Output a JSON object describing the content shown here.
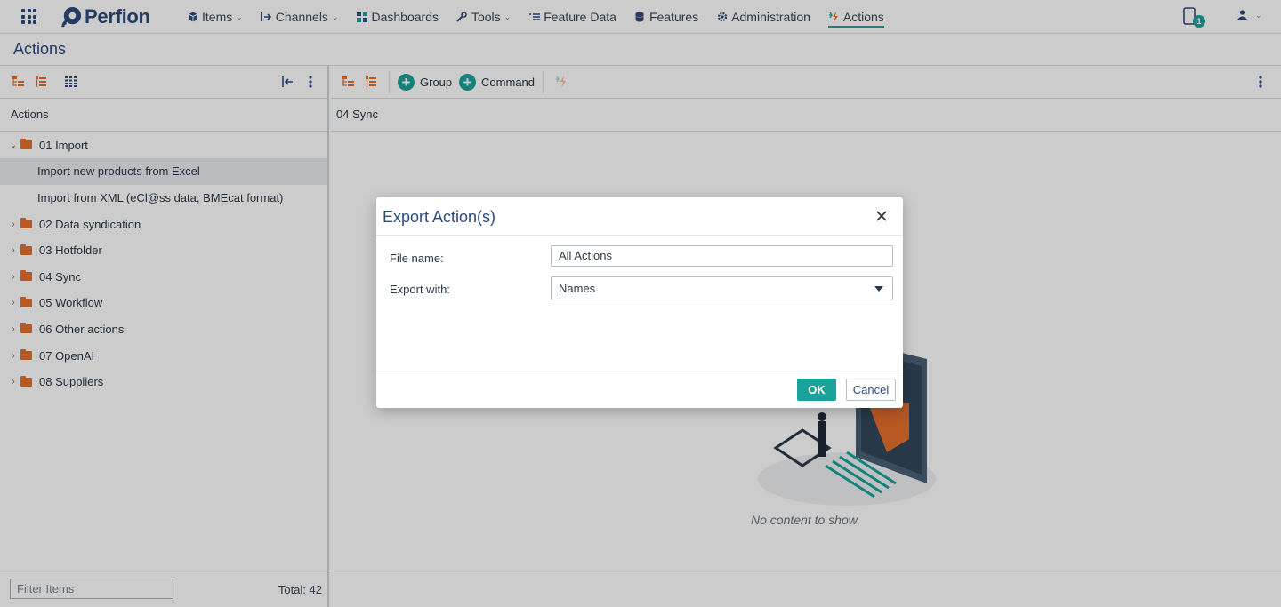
{
  "brand": {
    "name": "Perfion"
  },
  "colors": {
    "accent": "#1aa39a",
    "brand": "#2e4a7d",
    "folder": "#e66f2c"
  },
  "nav": {
    "items": [
      {
        "label": "Items",
        "icon": "cube-icon",
        "has_dropdown": true
      },
      {
        "label": "Channels",
        "icon": "channels-icon",
        "has_dropdown": true
      },
      {
        "label": "Dashboards",
        "icon": "dashboard-icon",
        "has_dropdown": false
      },
      {
        "label": "Tools",
        "icon": "wrench-icon",
        "has_dropdown": true
      },
      {
        "label": "Feature Data",
        "icon": "list-icon",
        "has_dropdown": false
      },
      {
        "label": "Features",
        "icon": "database-icon",
        "has_dropdown": false
      },
      {
        "label": "Administration",
        "icon": "gear-icon",
        "has_dropdown": false
      },
      {
        "label": "Actions",
        "icon": "actions-icon",
        "has_dropdown": false,
        "active": true
      }
    ],
    "notification_count": "1"
  },
  "page": {
    "title": "Actions"
  },
  "left_panel": {
    "header": "Actions",
    "tree": [
      {
        "label": "01 Import",
        "expanded": true
      },
      {
        "label": "Import new products from Excel",
        "child": true,
        "selected": true
      },
      {
        "label": "Import from XML (eCl@ss data, BMEcat format)",
        "child": true
      },
      {
        "label": "02 Data syndication",
        "expanded": false
      },
      {
        "label": "03 Hotfolder",
        "expanded": false
      },
      {
        "label": "04 Sync",
        "expanded": false
      },
      {
        "label": "05 Workflow",
        "expanded": false
      },
      {
        "label": "06 Other actions",
        "expanded": false
      },
      {
        "label": "07 OpenAI",
        "expanded": false
      },
      {
        "label": "08 Suppliers",
        "expanded": false
      }
    ],
    "filter_placeholder": "Filter Items",
    "total": "Total: 42"
  },
  "right_panel": {
    "group_label": "Group",
    "command_label": "Command",
    "header": "04 Sync",
    "empty_text": "No content to show"
  },
  "dialog": {
    "title": "Export Action(s)",
    "file_name_label": "File name:",
    "file_name_value": "All Actions",
    "export_with_label": "Export with:",
    "export_with_value": "Names",
    "ok_label": "OK",
    "cancel_label": "Cancel"
  }
}
